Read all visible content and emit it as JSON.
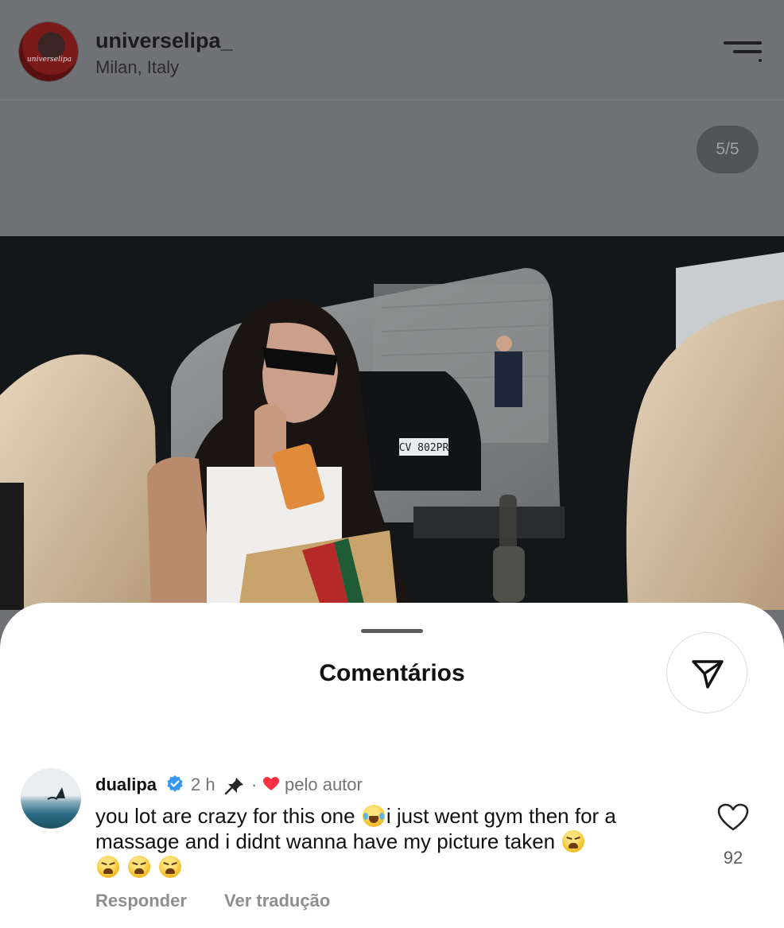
{
  "post": {
    "username": "universelipa_",
    "avatar_text": "universelipa",
    "location": "Milan, Italy",
    "counter": "5/5"
  },
  "sheet": {
    "title": "Comentários"
  },
  "comment": {
    "username": "dualipa",
    "time": "2 h",
    "separator": "·",
    "by_author": "pelo autor",
    "text_part1": "you lot are crazy for this one",
    "text_part2": "i just went gym then for a massage and i didnt wanna have my picture taken",
    "like_count": "92",
    "reply_label": "Responder",
    "translate_label": "Ver tradução"
  },
  "icons": {
    "menu": "menu-icon",
    "share": "send-icon",
    "verified": "verified-badge-icon",
    "pin": "pin-icon",
    "heart": "heart-icon"
  },
  "colors": {
    "verified": "#3797f0",
    "author_heart": "#ff3040",
    "dim_overlay": "#6f7174"
  }
}
